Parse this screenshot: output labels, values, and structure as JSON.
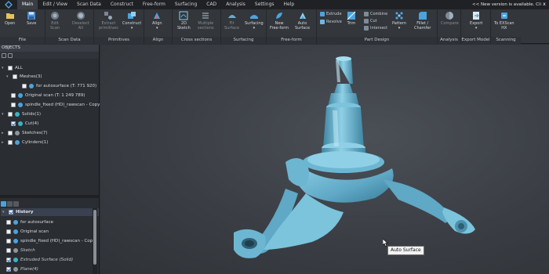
{
  "menu": {
    "items": [
      "Main",
      "Edit / View",
      "Scan Data",
      "Construct",
      "Free-form",
      "Surfacing",
      "CAD",
      "Analysis",
      "Settings",
      "Help"
    ],
    "new_version": "<< New version is available. Cli",
    "close": "x"
  },
  "ribbon": {
    "groups": {
      "file": "File",
      "scan_data": "Scan Data",
      "primitives": "Primitives",
      "align": "Align",
      "cross_sections": "Cross sections",
      "surfacing": "Surfacing",
      "free_form": "Free-form",
      "part_design": "Part Design",
      "analysis": "Analysis",
      "export_model": "Export Model",
      "scanning": "Scanning"
    },
    "buttons": {
      "open": "Open",
      "save": "Save",
      "edit_scan_1": "Edit",
      "edit_scan_2": "Scan",
      "deselect_1": "Deselect",
      "deselect_2": "All",
      "extract_1": "Extract",
      "extract_2": "primitives",
      "construct": "Construct",
      "align": "Align",
      "sketch_1": "2D",
      "sketch_2": "Sketch",
      "multiple_1": "Multiple",
      "multiple_2": "sections",
      "fit_1": "Fit",
      "fit_2": "Surface",
      "surfacing": "Surfacing",
      "new_ff_1": "New",
      "new_ff_2": "Free-form",
      "auto_1": "Auto",
      "auto_2": "Surface",
      "extrude": "Extrude",
      "revolve": "Revolve",
      "trim": "Trim",
      "combine": "Combine",
      "cut": "Cut",
      "intersect": "Intersect",
      "pattern": "Pattern",
      "fillet_1": "Fillet /",
      "fillet_2": "Chamfer",
      "compare": "Compare",
      "export": "Export",
      "to_exscan_1": "To EXScan",
      "to_exscan_2": "HX"
    }
  },
  "objects": {
    "header": "OBJECTS",
    "tree": [
      {
        "label": "ALL",
        "checked": false
      },
      {
        "label": "Meshes(3)",
        "checked": false
      },
      {
        "label": "for autosurface (T: 771 920)",
        "checked": false
      },
      {
        "label": "Original scan (T: 1 249 789)",
        "checked": false
      },
      {
        "label": "spindle_fixed (HD)_rawscan - Copy",
        "checked": false
      },
      {
        "label": "Solids(1)",
        "checked": false
      },
      {
        "label": "Cut(4)",
        "checked": true
      },
      {
        "label": "Sketches(7)",
        "checked": false
      },
      {
        "label": "Cylinders(1)",
        "checked": false
      }
    ]
  },
  "history": {
    "header": "History",
    "items": [
      {
        "label": "for autosurface",
        "italic": false,
        "checked": false
      },
      {
        "label": "Original scan",
        "italic": false,
        "checked": false
      },
      {
        "label": "spindle_fixed (HD)_rawscan - Copy",
        "italic": false,
        "checked": false
      },
      {
        "label": "Sketch",
        "italic": true,
        "checked": false
      },
      {
        "label": "Extruded Surface (Solid)",
        "italic": true,
        "checked": true
      },
      {
        "label": "Plane(4)",
        "italic": true,
        "checked": true
      }
    ]
  },
  "viewport": {
    "tooltip": "Auto Surface"
  },
  "colors": {
    "accent": "#4aa3df",
    "model": "#7cc3dc",
    "model_shadow": "#3f86a3",
    "background": "#3a3e44"
  }
}
